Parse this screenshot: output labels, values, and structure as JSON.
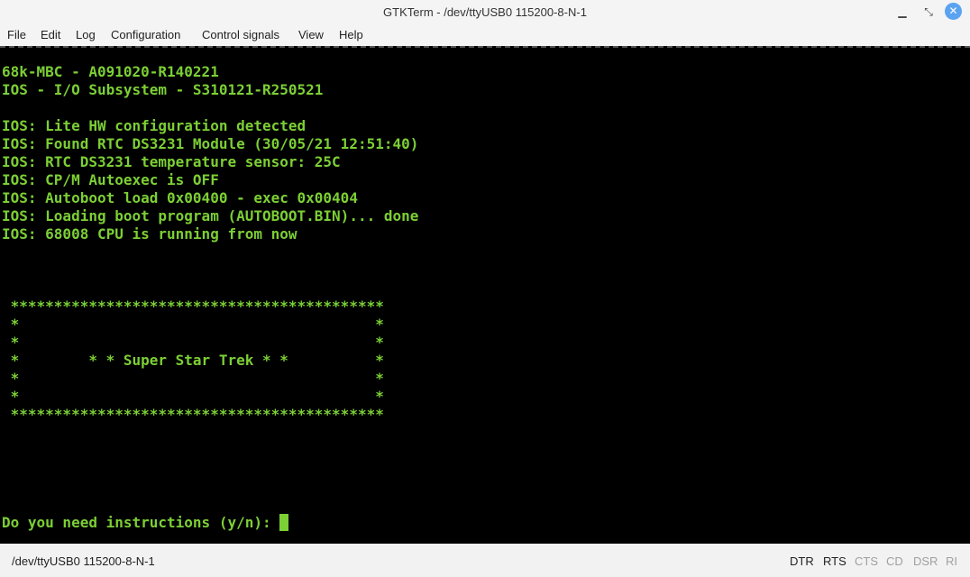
{
  "window": {
    "title": "GTKTerm - /dev/ttyUSB0  115200-8-N-1",
    "controls": {
      "minimize": "▁",
      "maximize": "⤡",
      "close": "✕"
    }
  },
  "menu": [
    "File",
    "Edit",
    "Log",
    "Configuration",
    "Control signals",
    "View",
    "Help"
  ],
  "terminal": {
    "text_color": "#7ccf35",
    "background": "#000000",
    "lines": [
      "68k-MBC - A091020-R140221",
      "IOS - I/O Subsystem - S310121-R250521",
      "",
      "IOS: Lite HW configuration detected",
      "IOS: Found RTC DS3231 Module (30/05/21 12:51:40)",
      "IOS: RTC DS3231 temperature sensor: 25C",
      "IOS: CP/M Autoexec is OFF",
      "IOS: Autoboot load 0x00400 - exec 0x00404",
      "IOS: Loading boot program (AUTOBOOT.BIN)... done",
      "IOS: 68008 CPU is running from now",
      "",
      "",
      "",
      " *******************************************",
      " *                                         *",
      " *                                         *",
      " *        * * Super Star Trek * *          *",
      " *                                         *",
      " *                                         *",
      " *******************************************"
    ],
    "prompt": "Do you need instructions (y/n): "
  },
  "status": {
    "port": "/dev/ttyUSB0  115200-8-N-1",
    "signals": [
      {
        "label": "DTR",
        "active": true
      },
      {
        "label": "RTS",
        "active": true
      },
      {
        "label": "CTS",
        "active": false
      },
      {
        "label": "CD",
        "active": false
      },
      {
        "label": "DSR",
        "active": false
      },
      {
        "label": "RI",
        "active": false
      }
    ]
  }
}
